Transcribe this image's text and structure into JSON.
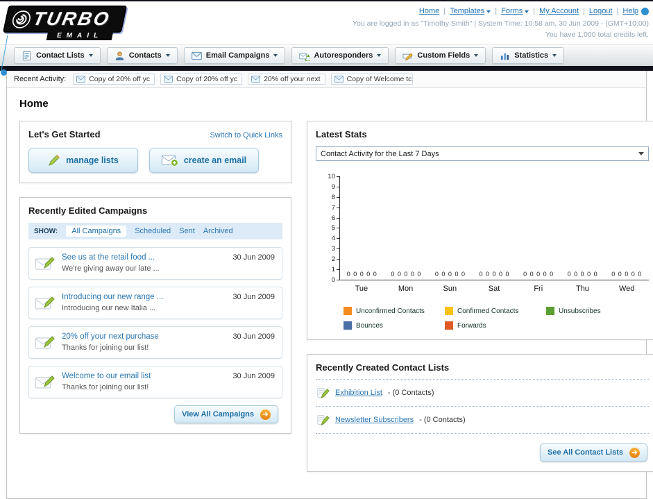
{
  "header": {
    "logo_line1": "TURBO",
    "logo_line2": "EMAIL",
    "nav_links": [
      {
        "label": "Home",
        "dropdown": false
      },
      {
        "label": "Templates",
        "dropdown": true
      },
      {
        "label": "Forms",
        "dropdown": true
      },
      {
        "label": "My Account",
        "dropdown": false
      },
      {
        "label": "Logout",
        "dropdown": false
      },
      {
        "label": "Help",
        "dropdown": false
      }
    ],
    "login_info": "You are logged in as \"Timothy Smith\" | System Time: 10:58 am, 30 Jun 2009 - (GMT+10:00)",
    "credits": "You have 1,000 total credits left."
  },
  "nav_tabs": [
    {
      "label": "Contact Lists"
    },
    {
      "label": "Contacts"
    },
    {
      "label": "Email Campaigns"
    },
    {
      "label": "Autoresponders"
    },
    {
      "label": "Custom Fields"
    },
    {
      "label": "Statistics"
    }
  ],
  "recent_activity": {
    "label": "Recent Activity:",
    "items": [
      "Copy of 20% off yc",
      "Copy of 20% off yc",
      "20% off your next",
      "Copy of Welcome tc"
    ]
  },
  "page_title": "Home",
  "get_started": {
    "title": "Let's Get Started",
    "switch_link": "Switch to Quick Links",
    "manage_lists_label": "manage lists",
    "create_email_label": "create an email"
  },
  "campaigns": {
    "title": "Recently Edited Campaigns",
    "show_label": "SHOW:",
    "tabs": [
      "All Campaigns",
      "Scheduled",
      "Sent",
      "Archived"
    ],
    "selected_tab": "All Campaigns",
    "items": [
      {
        "title": "See us at the retail food ...",
        "subtitle": "We're giving away our late ...",
        "date": "30 Jun 2009"
      },
      {
        "title": "Introducing our new range ...",
        "subtitle": "Introducing our new Italia ...",
        "date": "30 Jun 2009"
      },
      {
        "title": "20% off your next purchase",
        "subtitle": "Thanks for joining our list!",
        "date": "30 Jun 2009"
      },
      {
        "title": "Welcome to our email list",
        "subtitle": "Thanks for joining our list!",
        "date": "30 Jun 2009"
      }
    ],
    "view_all_label": "View All Campaigns"
  },
  "stats": {
    "title": "Latest Stats",
    "dropdown_value": "Contact Activity for the Last 7 Days",
    "legend": [
      {
        "label": "Unconfirmed Contacts",
        "color": "#f68b1f"
      },
      {
        "label": "Confirmed Contacts",
        "color": "#ffc20e"
      },
      {
        "label": "Unsubscribes",
        "color": "#5c9e31"
      },
      {
        "label": "Bounces",
        "color": "#4c6fa5"
      },
      {
        "label": "Forwards",
        "color": "#e05a26"
      }
    ]
  },
  "chart_data": {
    "type": "bar",
    "title": "Contact Activity for the Last 7 Days",
    "categories": [
      "Tue",
      "Mon",
      "Sun",
      "Sat",
      "Fri",
      "Thu",
      "Wed"
    ],
    "series": [
      {
        "name": "Unconfirmed Contacts",
        "values": [
          0,
          0,
          0,
          0,
          0,
          0,
          0
        ]
      },
      {
        "name": "Confirmed Contacts",
        "values": [
          0,
          0,
          0,
          0,
          0,
          0,
          0
        ]
      },
      {
        "name": "Unsubscribes",
        "values": [
          0,
          0,
          0,
          0,
          0,
          0,
          0
        ]
      },
      {
        "name": "Bounces",
        "values": [
          0,
          0,
          0,
          0,
          0,
          0,
          0
        ]
      },
      {
        "name": "Forwards",
        "values": [
          0,
          0,
          0,
          0,
          0,
          0,
          0
        ]
      }
    ],
    "xlabel": "",
    "ylabel": "",
    "ylim": [
      0,
      10
    ],
    "y_step": 1,
    "grid": false,
    "legend_position": "bottom"
  },
  "contact_lists": {
    "title": "Recently Created Contact Lists",
    "items": [
      {
        "name": "Exhibition List",
        "detail": "- (0 Contacts)"
      },
      {
        "name": "Newsletter Subscribers",
        "detail": "- (0 Contacts)"
      }
    ],
    "see_all_label": "See All Contact Lists"
  }
}
